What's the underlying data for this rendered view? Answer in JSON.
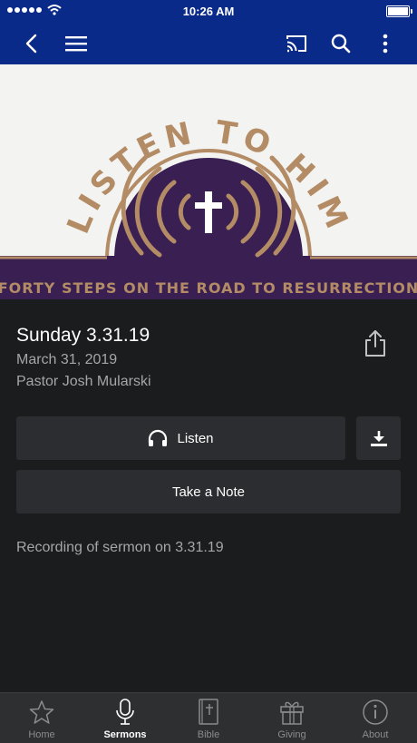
{
  "status_bar": {
    "time": "10:26 AM"
  },
  "nav": {
    "back_icon": "chevron-left-icon",
    "menu_icon": "hamburger-icon",
    "cast_icon": "cast-icon",
    "search_icon": "search-icon",
    "more_icon": "more-vertical-icon"
  },
  "artwork": {
    "title": "LISTEN TO HIM",
    "subtitle": "FORTY STEPS ON THE ROAD TO RESURRECTION",
    "colors": {
      "background": "#f3f3f1",
      "purple": "#3a1f52",
      "gold": "#b38c66"
    }
  },
  "sermon": {
    "title": "Sunday 3.31.19",
    "date": "March 31, 2019",
    "speaker": "Pastor Josh Mularski",
    "description": "Recording of sermon on 3.31.19"
  },
  "actions": {
    "listen_label": "Listen",
    "take_note_label": "Take a Note",
    "share_icon": "share-icon",
    "download_icon": "download-icon",
    "headphones_icon": "headphones-icon"
  },
  "tabs": [
    {
      "label": "Home",
      "icon": "star-icon",
      "active": false
    },
    {
      "label": "Sermons",
      "icon": "microphone-icon",
      "active": true
    },
    {
      "label": "Bible",
      "icon": "bible-icon",
      "active": false
    },
    {
      "label": "Giving",
      "icon": "gift-icon",
      "active": false
    },
    {
      "label": "About",
      "icon": "info-icon",
      "active": false
    }
  ],
  "colors": {
    "nav_bar": "#0a2a8a",
    "background": "#1b1c1e",
    "button": "#2c2d30",
    "secondary_text": "#a4a6aa",
    "tab_bar": "#2e2f31"
  }
}
